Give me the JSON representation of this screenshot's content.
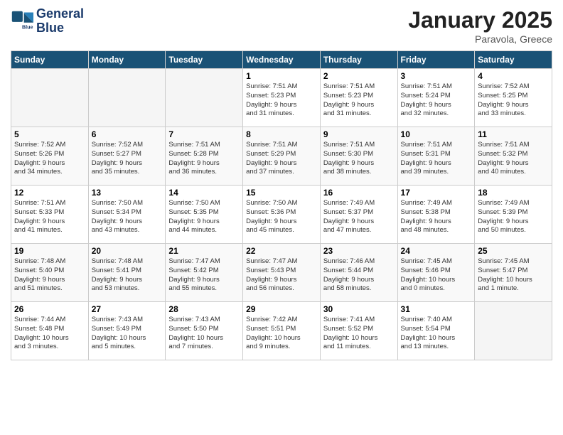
{
  "header": {
    "logo_line1": "General",
    "logo_line2": "Blue",
    "month": "January 2025",
    "location": "Paravola, Greece"
  },
  "days_of_week": [
    "Sunday",
    "Monday",
    "Tuesday",
    "Wednesday",
    "Thursday",
    "Friday",
    "Saturday"
  ],
  "weeks": [
    [
      {
        "day": "",
        "info": "",
        "empty": true
      },
      {
        "day": "",
        "info": "",
        "empty": true
      },
      {
        "day": "",
        "info": "",
        "empty": true
      },
      {
        "day": "1",
        "info": "Sunrise: 7:51 AM\nSunset: 5:23 PM\nDaylight: 9 hours\nand 31 minutes."
      },
      {
        "day": "2",
        "info": "Sunrise: 7:51 AM\nSunset: 5:23 PM\nDaylight: 9 hours\nand 31 minutes."
      },
      {
        "day": "3",
        "info": "Sunrise: 7:51 AM\nSunset: 5:24 PM\nDaylight: 9 hours\nand 32 minutes."
      },
      {
        "day": "4",
        "info": "Sunrise: 7:52 AM\nSunset: 5:25 PM\nDaylight: 9 hours\nand 33 minutes."
      }
    ],
    [
      {
        "day": "5",
        "info": "Sunrise: 7:52 AM\nSunset: 5:26 PM\nDaylight: 9 hours\nand 34 minutes."
      },
      {
        "day": "6",
        "info": "Sunrise: 7:52 AM\nSunset: 5:27 PM\nDaylight: 9 hours\nand 35 minutes."
      },
      {
        "day": "7",
        "info": "Sunrise: 7:51 AM\nSunset: 5:28 PM\nDaylight: 9 hours\nand 36 minutes."
      },
      {
        "day": "8",
        "info": "Sunrise: 7:51 AM\nSunset: 5:29 PM\nDaylight: 9 hours\nand 37 minutes."
      },
      {
        "day": "9",
        "info": "Sunrise: 7:51 AM\nSunset: 5:30 PM\nDaylight: 9 hours\nand 38 minutes."
      },
      {
        "day": "10",
        "info": "Sunrise: 7:51 AM\nSunset: 5:31 PM\nDaylight: 9 hours\nand 39 minutes."
      },
      {
        "day": "11",
        "info": "Sunrise: 7:51 AM\nSunset: 5:32 PM\nDaylight: 9 hours\nand 40 minutes."
      }
    ],
    [
      {
        "day": "12",
        "info": "Sunrise: 7:51 AM\nSunset: 5:33 PM\nDaylight: 9 hours\nand 41 minutes."
      },
      {
        "day": "13",
        "info": "Sunrise: 7:50 AM\nSunset: 5:34 PM\nDaylight: 9 hours\nand 43 minutes."
      },
      {
        "day": "14",
        "info": "Sunrise: 7:50 AM\nSunset: 5:35 PM\nDaylight: 9 hours\nand 44 minutes."
      },
      {
        "day": "15",
        "info": "Sunrise: 7:50 AM\nSunset: 5:36 PM\nDaylight: 9 hours\nand 45 minutes."
      },
      {
        "day": "16",
        "info": "Sunrise: 7:49 AM\nSunset: 5:37 PM\nDaylight: 9 hours\nand 47 minutes."
      },
      {
        "day": "17",
        "info": "Sunrise: 7:49 AM\nSunset: 5:38 PM\nDaylight: 9 hours\nand 48 minutes."
      },
      {
        "day": "18",
        "info": "Sunrise: 7:49 AM\nSunset: 5:39 PM\nDaylight: 9 hours\nand 50 minutes."
      }
    ],
    [
      {
        "day": "19",
        "info": "Sunrise: 7:48 AM\nSunset: 5:40 PM\nDaylight: 9 hours\nand 51 minutes."
      },
      {
        "day": "20",
        "info": "Sunrise: 7:48 AM\nSunset: 5:41 PM\nDaylight: 9 hours\nand 53 minutes."
      },
      {
        "day": "21",
        "info": "Sunrise: 7:47 AM\nSunset: 5:42 PM\nDaylight: 9 hours\nand 55 minutes."
      },
      {
        "day": "22",
        "info": "Sunrise: 7:47 AM\nSunset: 5:43 PM\nDaylight: 9 hours\nand 56 minutes."
      },
      {
        "day": "23",
        "info": "Sunrise: 7:46 AM\nSunset: 5:44 PM\nDaylight: 9 hours\nand 58 minutes."
      },
      {
        "day": "24",
        "info": "Sunrise: 7:45 AM\nSunset: 5:46 PM\nDaylight: 10 hours\nand 0 minutes."
      },
      {
        "day": "25",
        "info": "Sunrise: 7:45 AM\nSunset: 5:47 PM\nDaylight: 10 hours\nand 1 minute."
      }
    ],
    [
      {
        "day": "26",
        "info": "Sunrise: 7:44 AM\nSunset: 5:48 PM\nDaylight: 10 hours\nand 3 minutes."
      },
      {
        "day": "27",
        "info": "Sunrise: 7:43 AM\nSunset: 5:49 PM\nDaylight: 10 hours\nand 5 minutes."
      },
      {
        "day": "28",
        "info": "Sunrise: 7:43 AM\nSunset: 5:50 PM\nDaylight: 10 hours\nand 7 minutes."
      },
      {
        "day": "29",
        "info": "Sunrise: 7:42 AM\nSunset: 5:51 PM\nDaylight: 10 hours\nand 9 minutes."
      },
      {
        "day": "30",
        "info": "Sunrise: 7:41 AM\nSunset: 5:52 PM\nDaylight: 10 hours\nand 11 minutes."
      },
      {
        "day": "31",
        "info": "Sunrise: 7:40 AM\nSunset: 5:54 PM\nDaylight: 10 hours\nand 13 minutes."
      },
      {
        "day": "",
        "info": "",
        "empty": true
      }
    ]
  ]
}
